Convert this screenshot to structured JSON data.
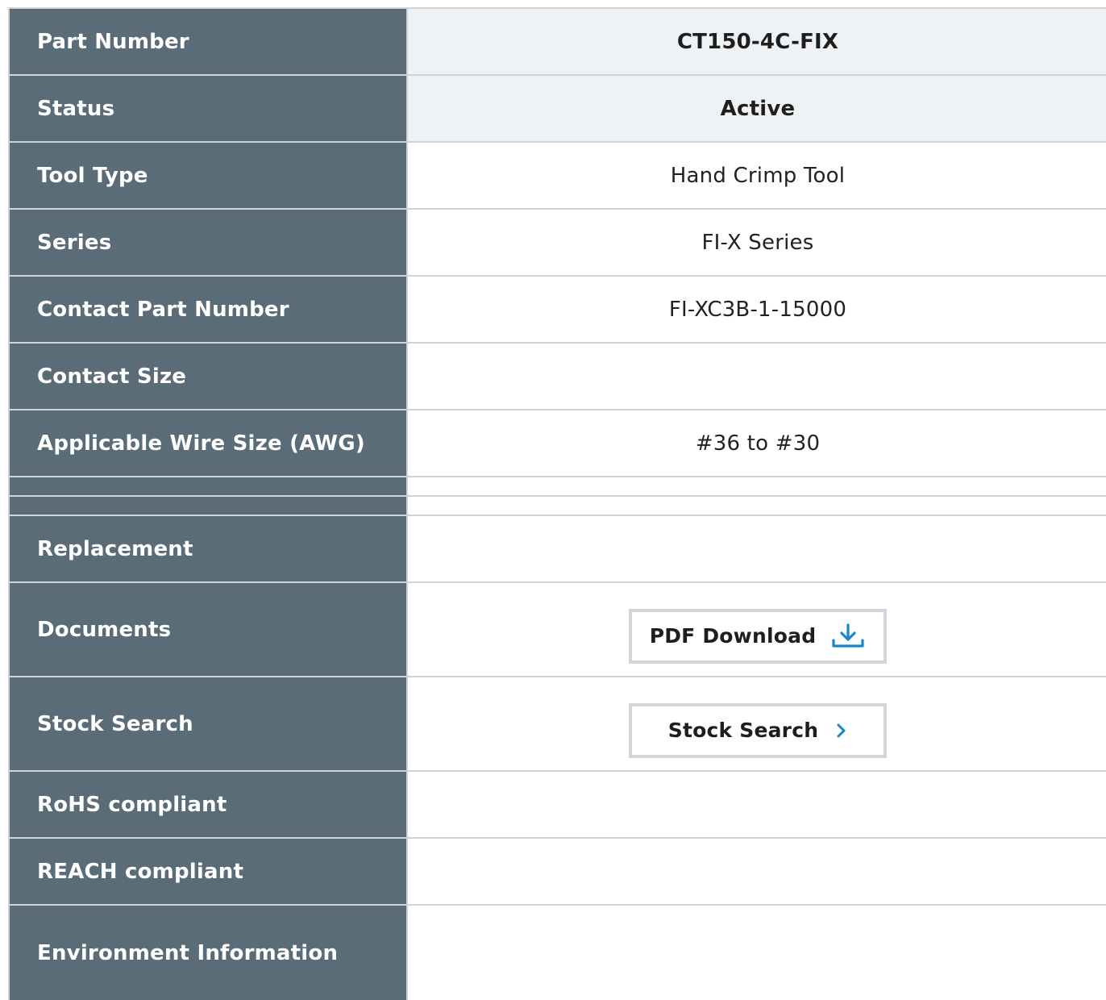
{
  "specs": {
    "part_number": {
      "label": "Part Number",
      "value": "CT150-4C-FIX"
    },
    "status": {
      "label": "Status",
      "value": "Active"
    },
    "tool_type": {
      "label": "Tool Type",
      "value": "Hand Crimp Tool"
    },
    "series": {
      "label": "Series",
      "value": "FI-X Series"
    },
    "contact_part_number": {
      "label": "Contact Part Number",
      "value": "FI-XC3B-1-15000"
    },
    "contact_size": {
      "label": "Contact Size",
      "value": ""
    },
    "wire_size": {
      "label": "Applicable Wire Size (AWG)",
      "value": "#36 to #30"
    },
    "replacement": {
      "label": "Replacement",
      "value": ""
    },
    "documents": {
      "label": "Documents",
      "button_label": "PDF Download",
      "icon": "download-icon"
    },
    "stock_search": {
      "label": "Stock Search",
      "button_label": "Stock Search",
      "icon": "chevron-right-icon"
    },
    "rohs": {
      "label": "RoHS compliant",
      "value": ""
    },
    "reach": {
      "label": "REACH compliant",
      "value": ""
    },
    "environment": {
      "label": "Environment Information",
      "value": ""
    }
  },
  "colors": {
    "label_bg": "#596c78",
    "highlight_bg": "#eff2f4",
    "border": "#cdd3d8",
    "accent": "#1a86c8"
  }
}
